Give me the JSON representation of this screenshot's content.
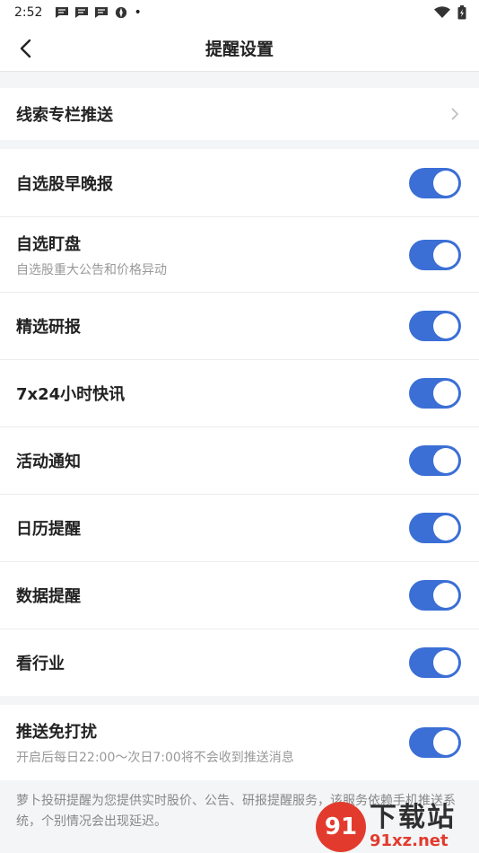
{
  "status_bar": {
    "time": "2:52",
    "dot": "•"
  },
  "nav": {
    "title": "提醒设置"
  },
  "clue_column": {
    "label": "线索专栏推送"
  },
  "settings": [
    {
      "label": "自选股早晚报",
      "sub": "",
      "enabled": true
    },
    {
      "label": "自选盯盘",
      "sub": "自选股重大公告和价格异动",
      "enabled": true
    },
    {
      "label": "精选研报",
      "sub": "",
      "enabled": true
    },
    {
      "label": "7x24小时快讯",
      "sub": "",
      "enabled": true
    },
    {
      "label": "活动通知",
      "sub": "",
      "enabled": true
    },
    {
      "label": "日历提醒",
      "sub": "",
      "enabled": true
    },
    {
      "label": "数据提醒",
      "sub": "",
      "enabled": true
    },
    {
      "label": "看行业",
      "sub": "",
      "enabled": true
    }
  ],
  "dnd": {
    "label": "推送免打扰",
    "sub": "开启后每日22:00～次日7:00将不会收到推送消息",
    "enabled": true
  },
  "footer": {
    "note": "萝卜投研提醒为您提供实时股价、公告、研报提醒服务，该服务依赖手机推送系统，个别情况会出现延迟。"
  },
  "watermark": {
    "cn": "下载站",
    "url": "91xz.net"
  },
  "colors": {
    "toggle_on": "#3b6fd6",
    "background": "#f4f5f7"
  }
}
